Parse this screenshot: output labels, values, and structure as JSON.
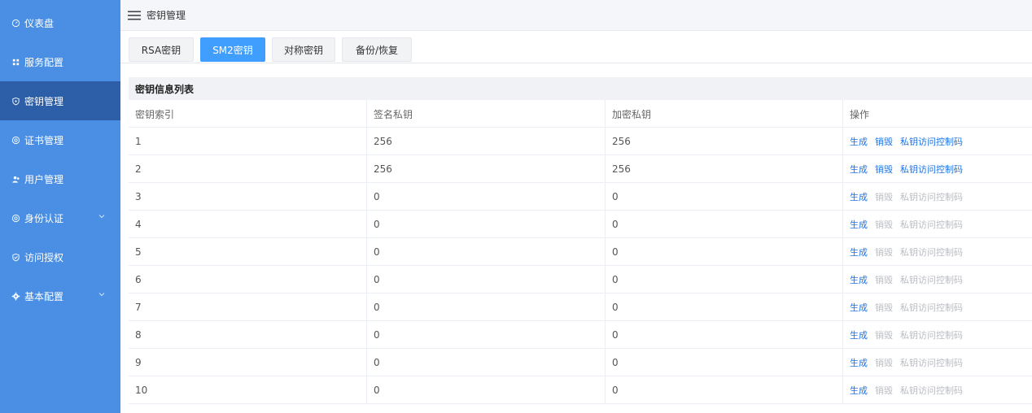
{
  "sidebar": {
    "items": [
      {
        "label": "仪表盘",
        "icon": "dashboard-icon"
      },
      {
        "label": "服务配置",
        "icon": "grid-icon"
      },
      {
        "label": "密钥管理",
        "icon": "key-icon"
      },
      {
        "label": "证书管理",
        "icon": "certificate-icon"
      },
      {
        "label": "用户管理",
        "icon": "users-icon"
      },
      {
        "label": "身份认证",
        "icon": "identity-icon"
      },
      {
        "label": "访问授权",
        "icon": "shield-icon"
      },
      {
        "label": "基本配置",
        "icon": "gear-icon"
      }
    ],
    "active_index": 2,
    "accent": "#4a8fe3",
    "active_color": "#2d5fa8"
  },
  "header": {
    "title": "密钥管理",
    "menu_icon": "hamburger-icon"
  },
  "tabs": [
    {
      "label": "RSA密钥"
    },
    {
      "label": "SM2密钥"
    },
    {
      "label": "对称密钥"
    },
    {
      "label": "备份/恢复"
    }
  ],
  "active_tab": 1,
  "section": {
    "title": "密钥信息列表"
  },
  "table": {
    "columns": [
      "密钥索引",
      "签名私钥",
      "加密私钥",
      "操作"
    ],
    "rows": [
      {
        "index": "1",
        "sign": "256",
        "enc": "256",
        "enabled": true
      },
      {
        "index": "2",
        "sign": "256",
        "enc": "256",
        "enabled": true
      },
      {
        "index": "3",
        "sign": "0",
        "enc": "0",
        "enabled": false
      },
      {
        "index": "4",
        "sign": "0",
        "enc": "0",
        "enabled": false
      },
      {
        "index": "5",
        "sign": "0",
        "enc": "0",
        "enabled": false
      },
      {
        "index": "6",
        "sign": "0",
        "enc": "0",
        "enabled": false
      },
      {
        "index": "7",
        "sign": "0",
        "enc": "0",
        "enabled": false
      },
      {
        "index": "8",
        "sign": "0",
        "enc": "0",
        "enabled": false
      },
      {
        "index": "9",
        "sign": "0",
        "enc": "0",
        "enabled": false
      },
      {
        "index": "10",
        "sign": "0",
        "enc": "0",
        "enabled": false
      }
    ],
    "actions": {
      "generate": "生成",
      "destroy": "销毁",
      "access_code": "私钥访问控制码"
    },
    "link_color": "#1e74e6",
    "disabled_color": "#b9bcc2"
  }
}
